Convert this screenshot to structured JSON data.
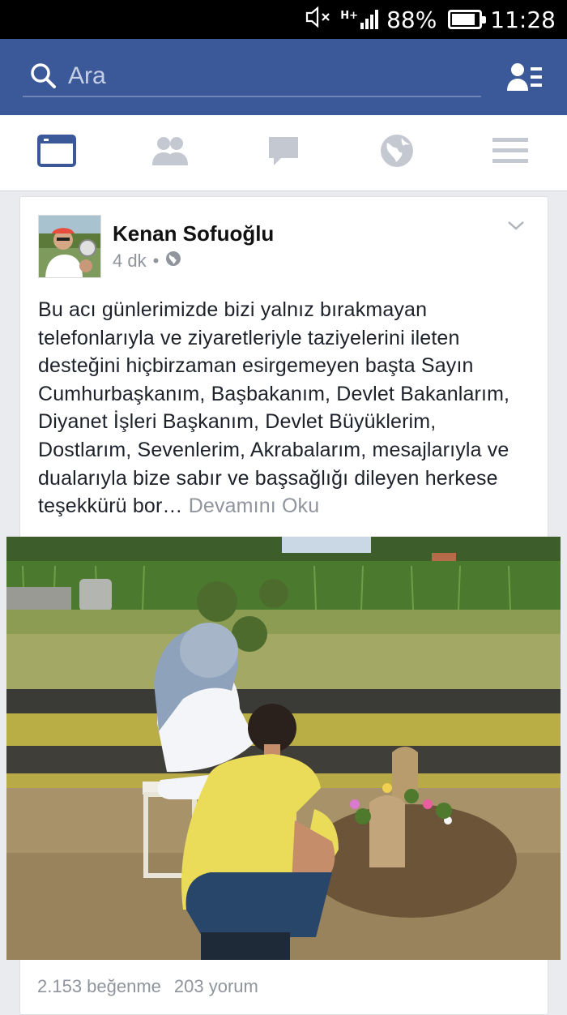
{
  "status_bar": {
    "battery": "88%",
    "time": "11:28",
    "battery_level": 0.88,
    "mute_icon": "speaker-muted-icon",
    "signal_icon": "signal-bars-icon",
    "network_label": "H+"
  },
  "header": {
    "search_placeholder": "Ara",
    "search_icon": "search-icon",
    "friend_requests_icon": "friend-requests-icon"
  },
  "tabs": [
    {
      "name": "news-feed",
      "icon": "news-feed-icon",
      "active": true
    },
    {
      "name": "friends",
      "icon": "friends-icon",
      "active": false
    },
    {
      "name": "messages",
      "icon": "messages-icon",
      "active": false
    },
    {
      "name": "notifications",
      "icon": "globe-icon",
      "active": false
    },
    {
      "name": "more",
      "icon": "menu-icon",
      "active": false
    }
  ],
  "post": {
    "author": "Kenan Sofuoğlu",
    "time": "4 dk",
    "separator": "•",
    "privacy_icon": "globe-icon",
    "text": "Bu acı günlerimizde bizi yalnız bırakmayan telefonlarıyla ve ziyaretleriyle taziyelerini ileten desteğini hiçbirzaman esirgemeyen başta Sayın Cumhurbaşkanım, Başbakanım, Devlet Bakanlarım, Diyanet İşleri Başkanım, Devlet Büyüklerim, Dostlarım, Sevenlerim, Akrabalarım, mesajlarıyla ve dualarıyla bize sabır ve başsağlığı dileyen herkese teşekkürü bor…",
    "see_more": "Devamını Oku",
    "likes": "2.153 beğenme",
    "comments": "203 yorum"
  },
  "colors": {
    "brand": "#3b5998",
    "active_tab": "#3b5998",
    "inactive_tab": "#c4c8d0"
  }
}
